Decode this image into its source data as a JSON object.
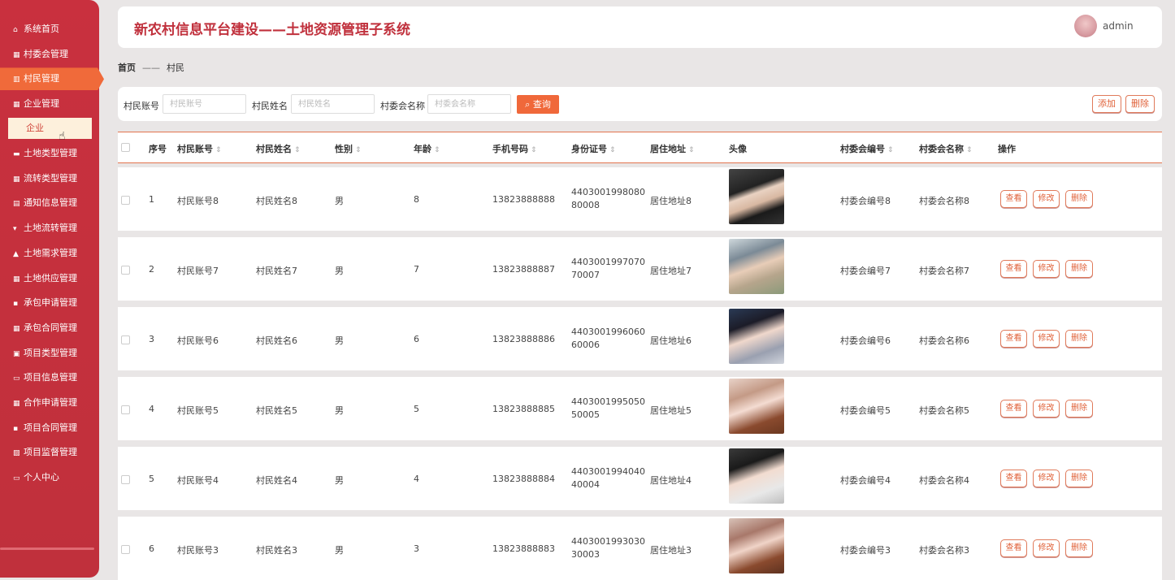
{
  "sidebar": {
    "items": [
      {
        "label": "系统首页",
        "icon": "home-icon"
      },
      {
        "label": "村委会管理",
        "icon": "grid-icon"
      },
      {
        "label": "村民管理",
        "icon": "chart-icon"
      },
      {
        "label": "企业管理",
        "icon": "grid-icon"
      },
      {
        "label": "土地类型管理",
        "icon": "bag-icon"
      },
      {
        "label": "流转类型管理",
        "icon": "grid-icon"
      },
      {
        "label": "通知信息管理",
        "icon": "doc-icon"
      },
      {
        "label": "土地流转管理",
        "icon": "cup-icon"
      },
      {
        "label": "土地需求管理",
        "icon": "thumb-icon"
      },
      {
        "label": "土地供应管理",
        "icon": "grid-icon"
      },
      {
        "label": "承包申请管理",
        "icon": "comment-icon"
      },
      {
        "label": "承包合同管理",
        "icon": "grid-icon"
      },
      {
        "label": "项目类型管理",
        "icon": "clipboard-icon"
      },
      {
        "label": "项目信息管理",
        "icon": "monitor-icon"
      },
      {
        "label": "合作申请管理",
        "icon": "grid-icon"
      },
      {
        "label": "项目合同管理",
        "icon": "comment-icon"
      },
      {
        "label": "项目监督管理",
        "icon": "image-icon"
      },
      {
        "label": "个人中心",
        "icon": "card-icon"
      }
    ],
    "sub_item": "企业",
    "active_index": 2
  },
  "header": {
    "title": "新农村信息平台建设——土地资源管理子系统",
    "username": "admin"
  },
  "breadcrumb": {
    "home": "首页",
    "sep": "——",
    "current": "村民"
  },
  "search": {
    "fields": [
      {
        "label": "村民账号",
        "placeholder": "村民账号"
      },
      {
        "label": "村民姓名",
        "placeholder": "村民姓名"
      },
      {
        "label": "村委会名称",
        "placeholder": "村委会名称"
      }
    ],
    "query_label": "查询",
    "add_label": "添加",
    "delete_label": "删除"
  },
  "table": {
    "columns": [
      "序号",
      "村民账号",
      "村民姓名",
      "性别",
      "年龄",
      "手机号码",
      "身份证号",
      "居住地址",
      "头像",
      "村委会编号",
      "村委会名称",
      "操作"
    ],
    "action_labels": {
      "view": "查看",
      "edit": "修改",
      "delete": "删除"
    },
    "rows": [
      {
        "no": "1",
        "account": "村民账号8",
        "name": "村民姓名8",
        "gender": "男",
        "age": "8",
        "phone": "13823888888",
        "id": "440300199808080008",
        "address": "居住地址8",
        "committee_no": "村委会编号8",
        "committee_name": "村委会名称8"
      },
      {
        "no": "2",
        "account": "村民账号7",
        "name": "村民姓名7",
        "gender": "男",
        "age": "7",
        "phone": "13823888887",
        "id": "440300199707070007",
        "address": "居住地址7",
        "committee_no": "村委会编号7",
        "committee_name": "村委会名称7"
      },
      {
        "no": "3",
        "account": "村民账号6",
        "name": "村民姓名6",
        "gender": "男",
        "age": "6",
        "phone": "13823888886",
        "id": "440300199606060006",
        "address": "居住地址6",
        "committee_no": "村委会编号6",
        "committee_name": "村委会名称6"
      },
      {
        "no": "4",
        "account": "村民账号5",
        "name": "村民姓名5",
        "gender": "男",
        "age": "5",
        "phone": "13823888885",
        "id": "440300199505050005",
        "address": "居住地址5",
        "committee_no": "村委会编号5",
        "committee_name": "村委会名称5"
      },
      {
        "no": "5",
        "account": "村民账号4",
        "name": "村民姓名4",
        "gender": "男",
        "age": "4",
        "phone": "13823888884",
        "id": "440300199404040004",
        "address": "居住地址4",
        "committee_no": "村委会编号4",
        "committee_name": "村委会名称4"
      },
      {
        "no": "6",
        "account": "村民账号3",
        "name": "村民姓名3",
        "gender": "男",
        "age": "3",
        "phone": "13823888883",
        "id": "440300199303030003",
        "address": "居住地址3",
        "committee_no": "村委会编号3",
        "committee_name": "村委会名称3"
      }
    ]
  },
  "colors": {
    "brand": "#c0303c",
    "accent": "#f0683a",
    "background": "#e9e6e6"
  }
}
